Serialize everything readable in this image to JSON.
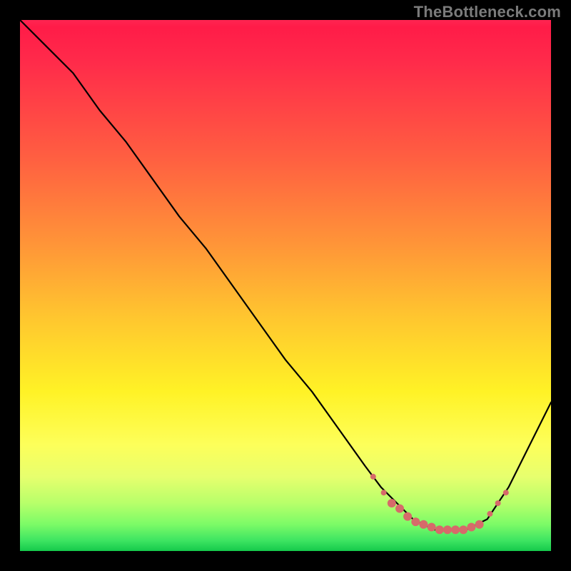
{
  "attribution": "TheBottleneck.com",
  "chart_data": {
    "type": "line",
    "title": "",
    "xlabel": "",
    "ylabel": "",
    "xlim": [
      0,
      100
    ],
    "ylim": [
      0,
      100
    ],
    "grid": false,
    "legend": false,
    "series": [
      {
        "name": "bottleneck-curve",
        "color": "#000000",
        "x": [
          0,
          5,
          10,
          15,
          20,
          25,
          30,
          35,
          40,
          45,
          50,
          55,
          60,
          65,
          68,
          70,
          72,
          74,
          76,
          78,
          80,
          82,
          84,
          86,
          88,
          90,
          92,
          100
        ],
        "y": [
          100,
          95,
          90,
          83,
          77,
          70,
          63,
          57,
          50,
          43,
          36,
          30,
          23,
          16,
          12,
          10,
          8,
          6,
          5,
          4,
          4,
          4,
          4,
          5,
          6,
          9,
          12,
          28
        ]
      }
    ],
    "markers": {
      "name": "highlight-dots",
      "color": "#d66a6a",
      "radius_small": 4,
      "radius_large": 6,
      "points": [
        {
          "x": 66.5,
          "y": 14,
          "r": "small"
        },
        {
          "x": 68.5,
          "y": 11,
          "r": "small"
        },
        {
          "x": 70.0,
          "y": 9,
          "r": "large"
        },
        {
          "x": 71.5,
          "y": 8,
          "r": "large"
        },
        {
          "x": 73.0,
          "y": 6.5,
          "r": "large"
        },
        {
          "x": 74.5,
          "y": 5.5,
          "r": "large"
        },
        {
          "x": 76.0,
          "y": 5,
          "r": "large"
        },
        {
          "x": 77.5,
          "y": 4.5,
          "r": "large"
        },
        {
          "x": 79.0,
          "y": 4,
          "r": "large"
        },
        {
          "x": 80.5,
          "y": 4,
          "r": "large"
        },
        {
          "x": 82.0,
          "y": 4,
          "r": "large"
        },
        {
          "x": 83.5,
          "y": 4,
          "r": "large"
        },
        {
          "x": 85.0,
          "y": 4.5,
          "r": "large"
        },
        {
          "x": 86.5,
          "y": 5,
          "r": "large"
        },
        {
          "x": 88.5,
          "y": 7,
          "r": "small"
        },
        {
          "x": 90.0,
          "y": 9,
          "r": "small"
        },
        {
          "x": 91.5,
          "y": 11,
          "r": "small"
        }
      ]
    }
  }
}
